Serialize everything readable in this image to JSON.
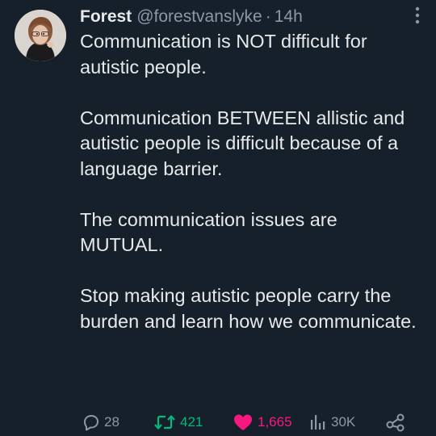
{
  "tweet": {
    "author": {
      "display_name": "Forest",
      "handle": "@forestvanslyke",
      "separator": "·",
      "time": "14h"
    },
    "paragraphs": [
      "Communication is NOT difficult for autistic people.",
      "Communication BETWEEN allistic and autistic people is difficult because of a language barrier.",
      "The communication issues are MUTUAL.",
      "Stop making autistic people carry the burden and learn how we communicate."
    ],
    "stats": {
      "replies": "28",
      "retweets": "421",
      "likes": "1,665",
      "views": "30K"
    }
  },
  "colors": {
    "background": "#15202b",
    "text_primary": "#e7e9ea",
    "text_secondary": "#8b98a5",
    "retweet_active": "#00ba7c",
    "like_active": "#f91880"
  },
  "icons": [
    "avatar",
    "more-icon",
    "reply-icon",
    "retweet-icon",
    "like-icon",
    "views-icon",
    "share-icon"
  ]
}
